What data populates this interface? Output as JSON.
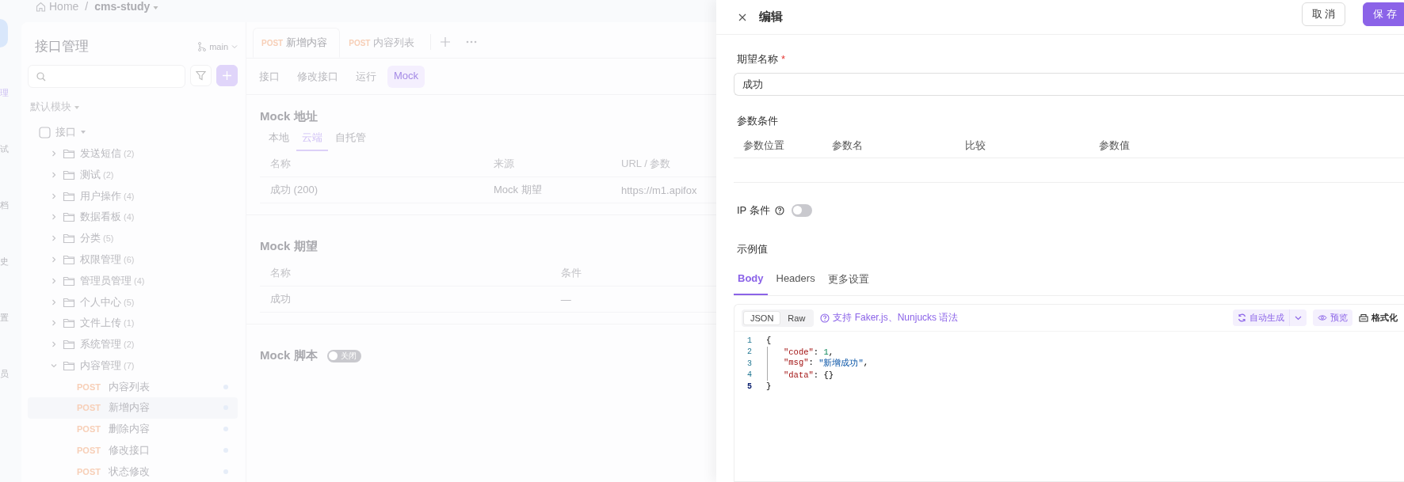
{
  "breadcrumb": {
    "home": "Home",
    "separator": "/",
    "project": "cms-study"
  },
  "rail": [
    "理",
    "试",
    "档",
    "史",
    "置",
    "员"
  ],
  "tree_panel": {
    "title": "接口管理",
    "branch": "main",
    "module": "默认模块",
    "root": {
      "kind": "group",
      "label": "接口",
      "expanded": true,
      "children": [
        {
          "kind": "folder",
          "label": "发送短信",
          "count": "(2)",
          "expanded": false
        },
        {
          "kind": "folder",
          "label": "测试",
          "count": "(2)",
          "expanded": false
        },
        {
          "kind": "folder",
          "label": "用户操作",
          "count": "(4)",
          "expanded": false
        },
        {
          "kind": "folder",
          "label": "数据看板",
          "count": "(4)",
          "expanded": false
        },
        {
          "kind": "folder",
          "label": "分类",
          "count": "(5)",
          "expanded": false
        },
        {
          "kind": "folder",
          "label": "权限管理",
          "count": "(6)",
          "expanded": false
        },
        {
          "kind": "folder",
          "label": "管理员管理",
          "count": "(4)",
          "expanded": false
        },
        {
          "kind": "folder",
          "label": "个人中心",
          "count": "(5)",
          "expanded": false
        },
        {
          "kind": "folder",
          "label": "文件上传",
          "count": "(1)",
          "expanded": false
        },
        {
          "kind": "folder",
          "label": "系统管理",
          "count": "(2)",
          "expanded": false
        },
        {
          "kind": "folder",
          "label": "内容管理",
          "count": "(7)",
          "expanded": true,
          "children": [
            {
              "kind": "endpoint",
              "method": "POST",
              "label": "内容列表",
              "selected": false
            },
            {
              "kind": "endpoint",
              "method": "POST",
              "label": "新增内容",
              "selected": true
            },
            {
              "kind": "endpoint",
              "method": "POST",
              "label": "删除内容",
              "selected": false
            },
            {
              "kind": "endpoint",
              "method": "POST",
              "label": "修改接口",
              "selected": false
            },
            {
              "kind": "endpoint",
              "method": "POST",
              "label": "状态修改",
              "selected": false
            }
          ]
        }
      ]
    }
  },
  "request_tabs": [
    {
      "method": "POST",
      "label": "新增内容",
      "selected": true
    },
    {
      "method": "POST",
      "label": "内容列表",
      "selected": false
    }
  ],
  "sub_tabs": [
    {
      "label": "接口",
      "selected": false
    },
    {
      "label": "修改接口",
      "selected": false
    },
    {
      "label": "运行",
      "selected": false
    },
    {
      "label": "Mock",
      "selected": true
    }
  ],
  "mock_address": {
    "title": "Mock 地址",
    "tabs": [
      {
        "label": "本地",
        "selected": false
      },
      {
        "label": "云端",
        "selected": true
      },
      {
        "label": "自托管",
        "selected": false
      }
    ],
    "columns": [
      "名称",
      "来源",
      "URL / 参数"
    ],
    "rows": [
      [
        "成功 (200)",
        "Mock 期望",
        "https://m1.apifox"
      ]
    ]
  },
  "mock_expectations": {
    "title": "Mock 期望",
    "columns": [
      "名称",
      "条件"
    ],
    "rows": [
      [
        "成功",
        "—"
      ]
    ]
  },
  "mock_script": {
    "title": "Mock 脚本",
    "on": false,
    "label": "关闭"
  },
  "drawer": {
    "title": "编辑",
    "cancel": "取 消",
    "save": "保 存",
    "name_field": {
      "label": "期望名称",
      "required_mark": "*",
      "value": "成功"
    },
    "conditions": {
      "label": "参数条件",
      "columns": [
        "参数位置",
        "参数名",
        "比较",
        "参数值"
      ]
    },
    "ip": {
      "label": "IP 条件",
      "on": false
    },
    "example": {
      "label": "示例值",
      "tabs": [
        {
          "label": "Body",
          "selected": true
        },
        {
          "label": "Headers",
          "selected": false
        },
        {
          "label": "更多设置",
          "selected": false
        }
      ],
      "modes": [
        {
          "label": "JSON",
          "selected": true
        },
        {
          "label": "Raw",
          "selected": false
        }
      ],
      "hint": "支持 Faker.js、Nunjucks 语法",
      "auto": "自动生成",
      "preview": "预览",
      "format": "格式化",
      "lines": [
        {
          "number": "1",
          "active": false,
          "indented": false,
          "tokens": [
            {
              "kind": "punct",
              "text": "{"
            }
          ]
        },
        {
          "number": "2",
          "active": false,
          "indented": true,
          "tokens": [
            {
              "kind": "key",
              "text": "\"code\""
            },
            {
              "kind": "punct",
              "text": ": "
            },
            {
              "kind": "number",
              "text": "1"
            },
            {
              "kind": "punct",
              "text": ","
            }
          ]
        },
        {
          "number": "3",
          "active": false,
          "indented": true,
          "tokens": [
            {
              "kind": "key",
              "text": "\"msg\""
            },
            {
              "kind": "punct",
              "text": ": "
            },
            {
              "kind": "string",
              "text": "\"新增成功\""
            },
            {
              "kind": "punct",
              "text": ","
            }
          ]
        },
        {
          "number": "4",
          "active": false,
          "indented": true,
          "tokens": [
            {
              "kind": "key",
              "text": "\"data\""
            },
            {
              "kind": "punct",
              "text": ": {}"
            }
          ]
        },
        {
          "number": "5",
          "active": true,
          "indented": false,
          "tokens": [
            {
              "kind": "punct",
              "text": "}"
            }
          ]
        }
      ]
    }
  }
}
